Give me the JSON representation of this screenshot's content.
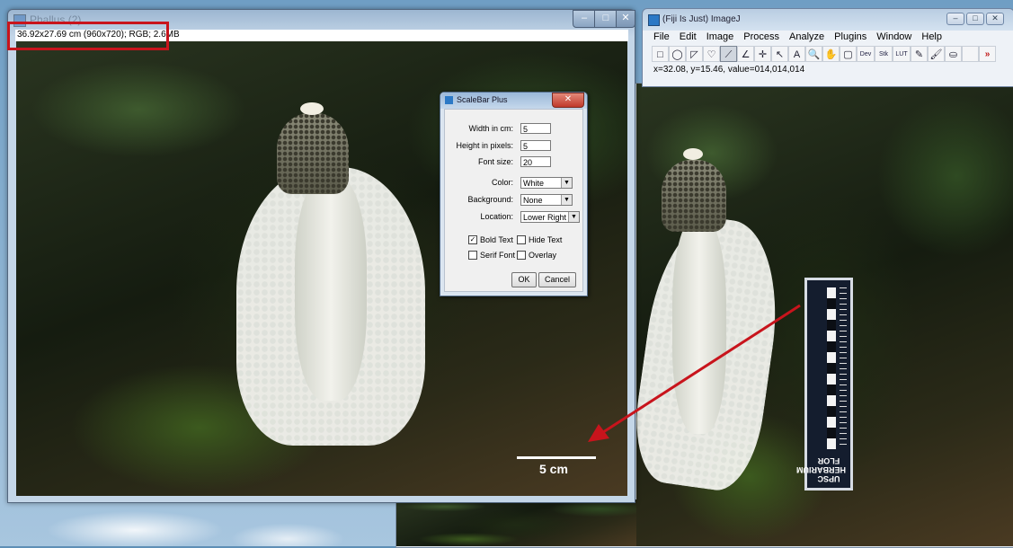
{
  "main_window": {
    "title": "Phallus (2)",
    "image_info": "36.92x27.69 cm (960x720); RGB; 2.6MB",
    "controls": {
      "minimize": "–",
      "maximize": "□",
      "close": "✕"
    }
  },
  "image_overlay": {
    "scale_bar_label": "5 cm"
  },
  "fiji": {
    "title": "(Fiji Is Just) ImageJ",
    "menu": [
      "File",
      "Edit",
      "Image",
      "Process",
      "Analyze",
      "Plugins",
      "Window",
      "Help"
    ],
    "tools": [
      {
        "name": "rectangle-tool-icon",
        "glyph": "□"
      },
      {
        "name": "oval-tool-icon",
        "glyph": "◯"
      },
      {
        "name": "polygon-tool-icon",
        "glyph": "◸"
      },
      {
        "name": "freehand-tool-icon",
        "glyph": "♡"
      },
      {
        "name": "line-tool-icon",
        "glyph": "⟋"
      },
      {
        "name": "angle-tool-icon",
        "glyph": "∠"
      },
      {
        "name": "point-tool-icon",
        "glyph": "✛"
      },
      {
        "name": "wand-tool-icon",
        "glyph": "↖"
      },
      {
        "name": "text-tool-icon",
        "glyph": "A"
      },
      {
        "name": "magnifier-tool-icon",
        "glyph": "🔍"
      },
      {
        "name": "scroll-tool-icon",
        "glyph": "✋"
      },
      {
        "name": "color-picker-tool-icon",
        "glyph": "▢"
      },
      {
        "name": "dev-tool-icon",
        "glyph": "Dev"
      },
      {
        "name": "stack-tool-icon",
        "glyph": "Stk"
      },
      {
        "name": "lut-tool-icon",
        "glyph": "LUT"
      },
      {
        "name": "pencil-tool-icon",
        "glyph": "✎"
      },
      {
        "name": "brush-tool-icon",
        "glyph": "🖌"
      },
      {
        "name": "flood-fill-tool-icon",
        "glyph": "⛀"
      },
      {
        "name": "blank-tool-icon",
        "glyph": ""
      },
      {
        "name": "more-tools-icon",
        "glyph": "»"
      }
    ],
    "status": "x=32.08, y=15.46, value=014,014,014"
  },
  "dialog": {
    "title": "ScaleBar Plus",
    "fields": {
      "width_label": "Width in cm:",
      "width_value": "5",
      "height_label": "Height in pixels:",
      "height_value": "5",
      "font_label": "Font size:",
      "font_value": "20"
    },
    "selects": {
      "color_label": "Color:",
      "color_value": "White",
      "background_label": "Background:",
      "background_value": "None",
      "location_label": "Location:",
      "location_value": "Lower Right"
    },
    "checkboxes": {
      "bold_text": "Bold Text",
      "bold_checked": "✓",
      "hide_text": "Hide Text",
      "serif_font": "Serif Font",
      "overlay": "Overlay"
    },
    "ok_label": "OK",
    "cancel_label": "Cancel"
  },
  "ruler": {
    "label": "UPSC HERBARIUM FLOR"
  }
}
